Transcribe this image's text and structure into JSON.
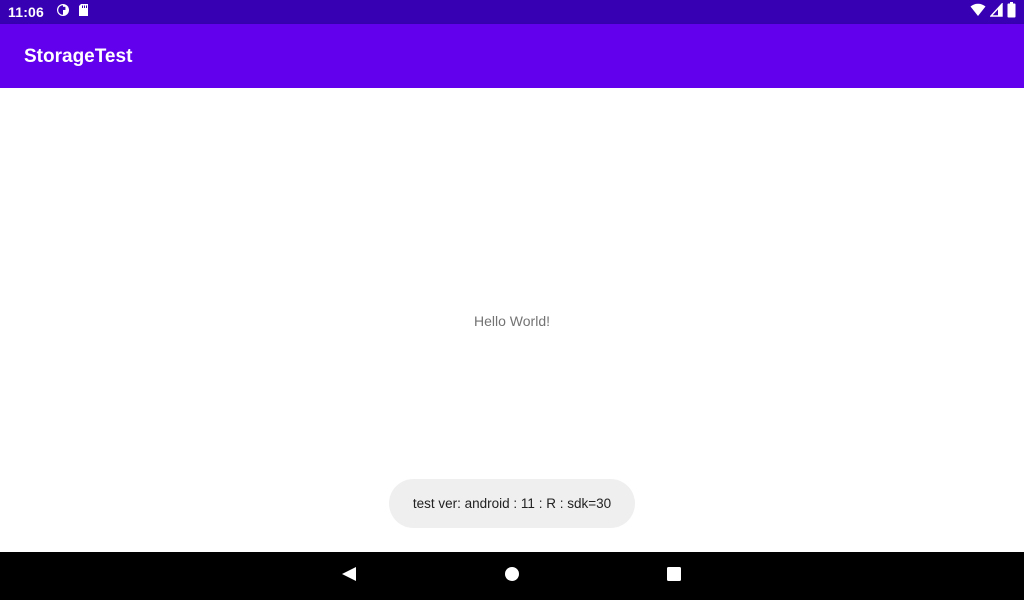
{
  "status_bar": {
    "time": "11:06",
    "left_icons": [
      "sync-icon",
      "sd-card-icon"
    ],
    "right_icons": [
      "wifi-icon",
      "cell-signal-icon",
      "battery-icon"
    ],
    "color": "#3700b3"
  },
  "app_bar": {
    "title": "StorageTest",
    "color": "#6200ee"
  },
  "content": {
    "hello_text": "Hello World!"
  },
  "toast": {
    "text": "test ver: android : 11 : R : sdk=30"
  },
  "nav_bar": {
    "buttons": [
      "back-icon",
      "home-icon",
      "recents-icon"
    ]
  }
}
